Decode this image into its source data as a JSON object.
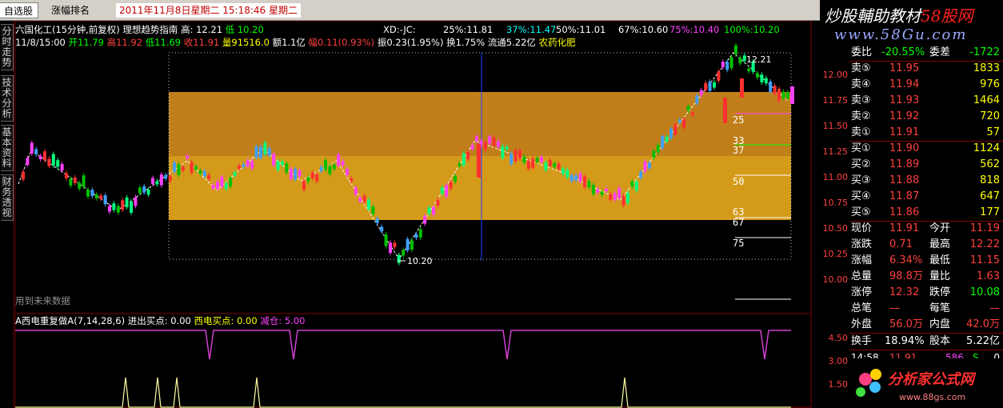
{
  "tabs": [
    {
      "label": "自选股"
    },
    {
      "label": "涨幅排名"
    }
  ],
  "datetime": "2011年11月8日星期二  15:18:46 星期二",
  "banner": {
    "title_a": "炒股輔助教材",
    "title_b": "58股网",
    "url": "www.58Gu.com"
  },
  "side_tabs": [
    "分时走势",
    "技术分析",
    "基本资料",
    "财务透视"
  ],
  "header_line1": {
    "stock": "六国化工(15分钟,前复权)",
    "indicator": "理想趋势指南",
    "high_label": "高:",
    "high": "12.21",
    "low_label": "低",
    "low": "10.20",
    "xd": "XD:-JC:",
    "p25": "25%:11.81",
    "p37": "37%:11.47",
    "p50": "50%:11.01",
    "p67": "67%:10.60",
    "p75": "75%:10.40",
    "p100": "100%:10.20"
  },
  "header_line2": {
    "time": "11/8/15:00",
    "open": "开11.79",
    "high": "高11.92",
    "low": "低11.69",
    "close": "收11.91",
    "vol": "量91516.0",
    "amt": "额1.1亿",
    "amp": "幅0.11(0.93%)",
    "zhenfu": "振0.23(1.95%)",
    "turn": "换1.75%",
    "float": "流通5.22亿",
    "sector": "农药化肥"
  },
  "future_note": "用到未来数据",
  "indicator_line": {
    "name": "A西电重复做A(7,14,28,6)",
    "in_label": "进出买点:",
    "in_val": "0.00",
    "xd_label": "西电买点:",
    "xd_val": "0.00",
    "pos_label": "减仓:",
    "pos_val": "5.00"
  },
  "fib_labels": [
    "25",
    "33",
    "37",
    "50",
    "63",
    "67",
    "75"
  ],
  "peak_label": "12.21",
  "trough_label": "10.20",
  "y_axis": [
    "12.00",
    "11.75",
    "11.50",
    "11.25",
    "11.00",
    "10.75",
    "10.50",
    "10.25",
    "10.00"
  ],
  "y_axis_ind": [
    "4.50",
    "3.00",
    "1.50"
  ],
  "quote": {
    "weibi_label": "委比",
    "weibi": "-20.55%",
    "weicha_label": "委差",
    "weicha": "-1722",
    "sells": [
      {
        "label": "卖⑤",
        "price": "11.95",
        "vol": "1833"
      },
      {
        "label": "卖④",
        "price": "11.94",
        "vol": "976"
      },
      {
        "label": "卖③",
        "price": "11.93",
        "vol": "1464"
      },
      {
        "label": "卖②",
        "price": "11.92",
        "vol": "720"
      },
      {
        "label": "卖①",
        "price": "11.91",
        "vol": "57"
      }
    ],
    "buys": [
      {
        "label": "买①",
        "price": "11.90",
        "vol": "1124"
      },
      {
        "label": "买②",
        "price": "11.89",
        "vol": "562"
      },
      {
        "label": "买③",
        "price": "11.88",
        "vol": "818"
      },
      {
        "label": "买④",
        "price": "11.87",
        "vol": "647"
      },
      {
        "label": "买⑤",
        "price": "11.86",
        "vol": "177"
      }
    ],
    "stats": [
      {
        "l1": "现价",
        "v1": "11.91",
        "l2": "今开",
        "v2": "11.19"
      },
      {
        "l1": "涨跌",
        "v1": "0.71",
        "l2": "最高",
        "v2": "12.22"
      },
      {
        "l1": "涨幅",
        "v1": "6.34%",
        "l2": "最低",
        "v2": "11.15"
      },
      {
        "l1": "总量",
        "v1": "98.8万",
        "l2": "量比",
        "v2": "1.63"
      },
      {
        "l1": "涨停",
        "v1": "12.32",
        "l2": "跌停",
        "v2": "10.08"
      },
      {
        "l1": "总笔",
        "v1": "—",
        "l2": "每笔",
        "v2": "—"
      },
      {
        "l1": "外盘",
        "v1": "56.0万",
        "l2": "内盘",
        "v2": "42.0万"
      }
    ],
    "turnover_label": "换手",
    "turnover": "18.94%",
    "equity_label": "股本",
    "equity": "5.22亿",
    "tick": {
      "time": "14:58",
      "price": "11.91",
      "vol": "586",
      "side": "S",
      "extra": "0"
    }
  },
  "logo2": {
    "text": "分析家公式网",
    "url": "www.88gs.com"
  },
  "colors": {
    "up": "#ff3030",
    "down": "#00c000",
    "band_dark": "#b8860b",
    "band_light": "#d4a017",
    "indicator": "#d040d0"
  }
}
